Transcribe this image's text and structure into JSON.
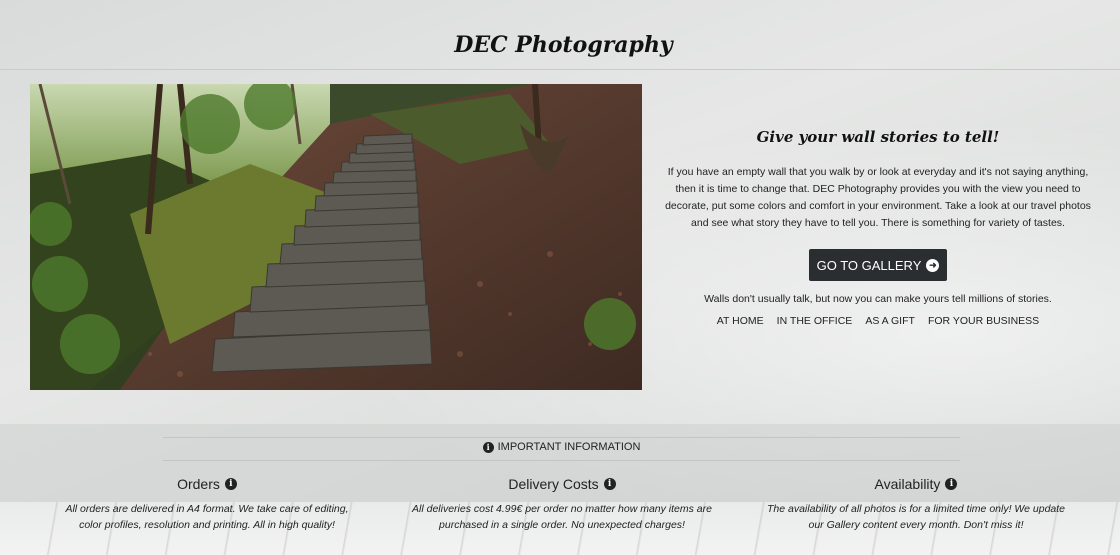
{
  "header": {
    "brand": "DEC Photography"
  },
  "hero": {
    "image_alt": "stone-staircase-forest-photo",
    "title": "Give your wall stories to tell!",
    "body": "If you have an empty wall that you walk by or look at everyday and it's not saying anything, then it is time to change that. DEC Photography provides you with the view you need to decorate, put some colors and comfort in your environment. Take a look at our travel photos and see what story they have to tell you. There is something for variety of tastes.",
    "button_label": "GO TO GALLERY",
    "button_icon": "arrow-circle-right-icon",
    "tagline": "Walls don't usually talk, but now you can make yours tell millions of stories.",
    "uses": [
      "AT HOME",
      "IN THE OFFICE",
      "AS A GIFT",
      "FOR YOUR BUSINESS"
    ]
  },
  "info": {
    "heading": "IMPORTANT INFORMATION",
    "icon": "info-circle-icon",
    "columns": [
      {
        "title": "Orders",
        "body": "All orders are delivered in A4 format. We take care of editing, color profiles, resolution and printing. All in high quality!"
      },
      {
        "title": "Delivery Costs",
        "body": "All deliveries cost 4.99€ per order no matter how many items are purchased in a single order. No unexpected charges!"
      },
      {
        "title": "Availability",
        "body": "The availability of all photos is for a limited time only! We update our Gallery content every month. Don't miss it!"
      }
    ]
  },
  "colors": {
    "button_bg": "#2b2e31",
    "text": "#222222"
  }
}
